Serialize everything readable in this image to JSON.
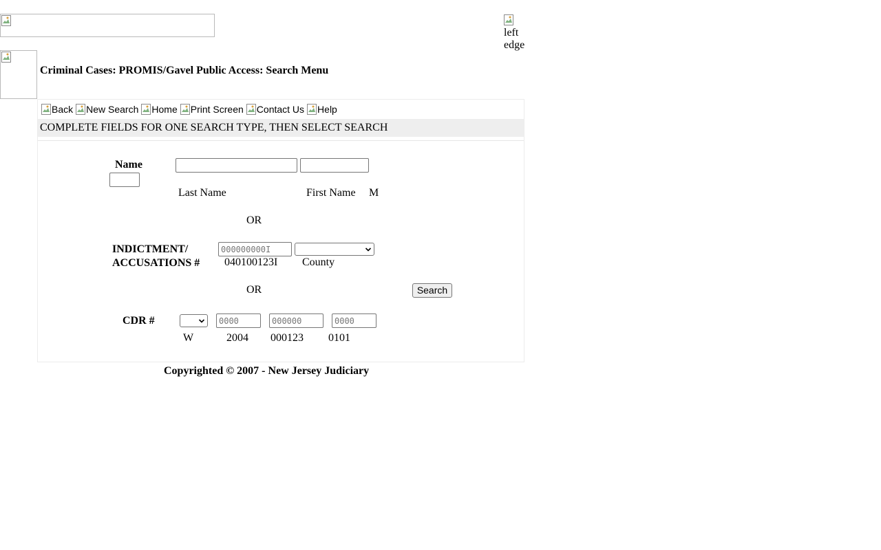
{
  "header": {
    "banner_alt": "",
    "edge_image_alt": "left edge",
    "title": "Criminal Cases: PROMIS/Gavel Public Access: Search Menu"
  },
  "nav": {
    "items": [
      {
        "label": "Back"
      },
      {
        "label": "New Search"
      },
      {
        "label": "Home"
      },
      {
        "label": "Print Screen"
      },
      {
        "label": "Contact Us"
      },
      {
        "label": "Help"
      }
    ]
  },
  "instructions": "COMPLETE FIELDS FOR ONE SEARCH TYPE, THEN SELECT SEARCH",
  "name_search": {
    "label": "Name",
    "last_name": {
      "value": "",
      "hint": "Last Name"
    },
    "first_name": {
      "value": "",
      "hint": "First Name"
    },
    "middle": {
      "value": "",
      "hint": "M"
    }
  },
  "or_1": "OR",
  "indictment_search": {
    "label_line1": "INDICTMENT/",
    "label_line2": "ACCUSATIONS #",
    "number": {
      "value": "",
      "placeholder": "000000000I",
      "hint": "040100123I"
    },
    "county": {
      "selected": "",
      "hint": "County"
    }
  },
  "or_2": "OR",
  "search_button": "Search",
  "cdr_search": {
    "label": "CDR #",
    "type": {
      "selected": "",
      "hint": "W"
    },
    "year": {
      "value": "",
      "placeholder": "0000",
      "hint": "2004"
    },
    "sequence": {
      "value": "",
      "placeholder": "000000",
      "hint": "000123"
    },
    "suffix": {
      "value": "",
      "placeholder": "0000",
      "hint": "0101"
    }
  },
  "footer": "Copyrighted © 2007 - New Jersey Judiciary",
  "colors": {
    "instruction_band": "#eeeeee",
    "panel_border": "#ececec",
    "button_bg": "#efefef"
  }
}
